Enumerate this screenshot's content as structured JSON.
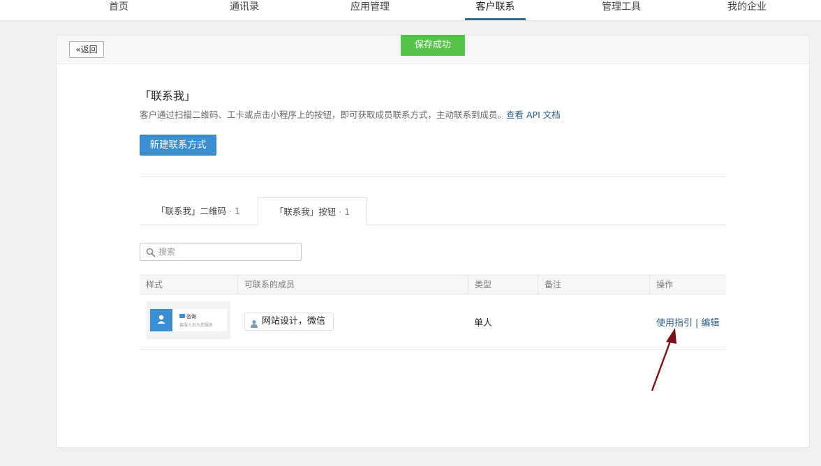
{
  "nav": {
    "items": [
      {
        "label": "首页"
      },
      {
        "label": "通讯录"
      },
      {
        "label": "应用管理"
      },
      {
        "label": "客户联系"
      },
      {
        "label": "管理工具"
      },
      {
        "label": "我的企业"
      }
    ],
    "active_index": 3
  },
  "header": {
    "back_label": "返回",
    "toast": "保存成功"
  },
  "section": {
    "title": "「联系我」",
    "desc": "客户通过扫描二维码、工卡或点击小程序上的按钮，即可获取成员联系方式，主动联系到成员。",
    "doc_link": "查看 API 文档",
    "new_button": "新建联系方式"
  },
  "tabs": [
    {
      "label": "「联系我」二维码",
      "count": "· 1"
    },
    {
      "label": "「联系我」按钮",
      "count": "· 1"
    }
  ],
  "active_tab": 1,
  "search": {
    "placeholder": "搜索"
  },
  "table": {
    "columns": [
      "样式",
      "可联系的成员",
      "类型",
      "备注",
      "操作"
    ],
    "rows": [
      {
        "preview": {
          "title": "咨询",
          "subtitle": "客服人员为您服务"
        },
        "member": "网站设计，微信",
        "type": "单人",
        "remark": "",
        "actions": [
          "使用指引",
          "编辑"
        ]
      }
    ]
  },
  "colors": {
    "primary": "#3b8ed0",
    "toast": "#57c34a",
    "link": "#2e5c82",
    "annotation_arrow": "#7a1018"
  }
}
